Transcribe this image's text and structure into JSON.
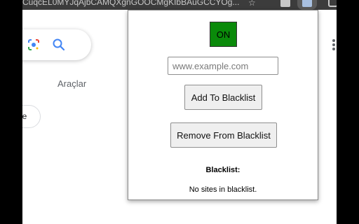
{
  "browser": {
    "url_fragment": "CuqcEL0MYJqAjbCAMQXgnGOOCMgKIbBAuGCCYOg...",
    "tools_label": "Araçlar",
    "chip_label": "ue"
  },
  "popup": {
    "toggle_label": "ON",
    "toggle_color": "#0a8a0a",
    "input_placeholder": "www.example.com",
    "input_value": "",
    "add_label": "Add To Blacklist",
    "remove_label": "Remove From Blacklist",
    "blacklist_title": "Blacklist:",
    "blacklist_empty": "No sites in blacklist."
  }
}
